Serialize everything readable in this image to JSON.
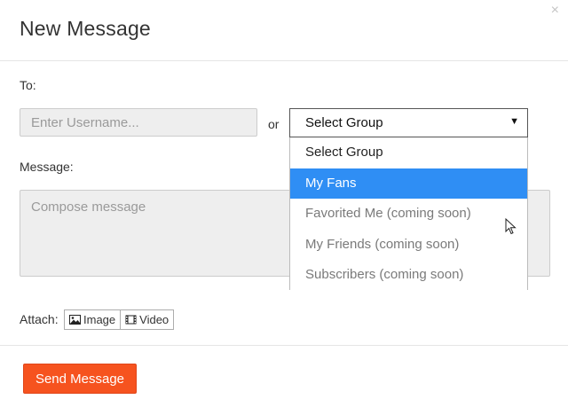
{
  "modal": {
    "title": "New Message",
    "close_glyph": "×"
  },
  "to": {
    "label": "To:",
    "username_placeholder": "Enter Username...",
    "or_text": "or"
  },
  "group_select": {
    "selected_value": "Select Group",
    "options": [
      {
        "label": "Select Group",
        "state": "normal"
      },
      {
        "label": "My Fans",
        "state": "highlighted"
      },
      {
        "label": "Favorited Me (coming soon)",
        "state": "disabled"
      },
      {
        "label": "My Friends (coming soon)",
        "state": "disabled"
      },
      {
        "label": "Subscribers (coming soon)",
        "state": "disabled"
      }
    ]
  },
  "message": {
    "label": "Message:",
    "placeholder": "Compose message"
  },
  "attach": {
    "label": "Attach:",
    "buttons": [
      {
        "label": "Image",
        "icon": "image-icon"
      },
      {
        "label": "Video",
        "icon": "film-icon"
      }
    ]
  },
  "footer": {
    "send_label": "Send Message"
  },
  "colors": {
    "accent": "#f6531f",
    "option_highlight": "#2f8ef4"
  }
}
